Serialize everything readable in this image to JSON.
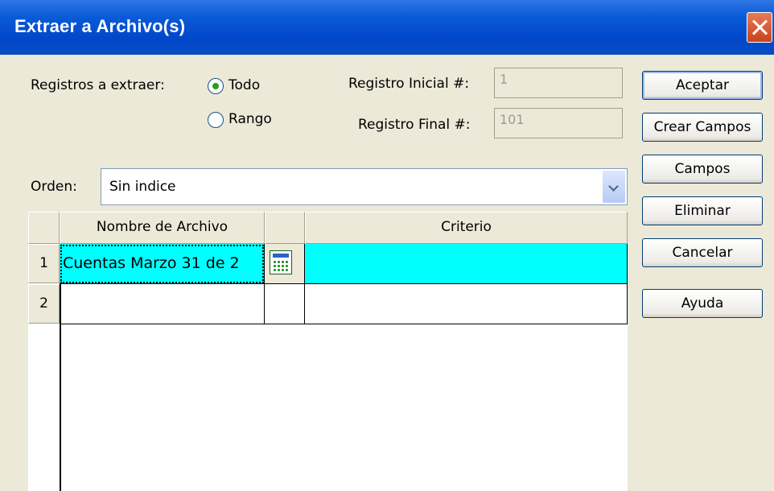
{
  "window": {
    "title": "Extraer a Archivo(s)"
  },
  "records": {
    "label": "Registros a extraer:",
    "option_all": "Todo",
    "option_range": "Rango",
    "selected": "Todo",
    "initial_label": "Registro Inicial #:",
    "initial_value": "1",
    "final_label": "Registro Final #:",
    "final_value": "101"
  },
  "order": {
    "label": "Orden:",
    "value": "Sin indice"
  },
  "grid": {
    "col_filename": "Nombre de Archivo",
    "col_criteria": "Criterio",
    "rows": [
      {
        "num": "1",
        "filename": "Cuentas Marzo 31 de 2",
        "criteria": ""
      },
      {
        "num": "2",
        "filename": "",
        "criteria": ""
      }
    ]
  },
  "buttons": {
    "accept": "Aceptar",
    "create_fields": "Crear Campos",
    "fields": "Campos",
    "delete": "Eliminar",
    "cancel": "Cancelar",
    "help": "Ayuda"
  },
  "colors": {
    "title_bar": "#0A4CC4",
    "selected_row": "#00FFFF",
    "dialog_bg": "#ECE9D8"
  }
}
